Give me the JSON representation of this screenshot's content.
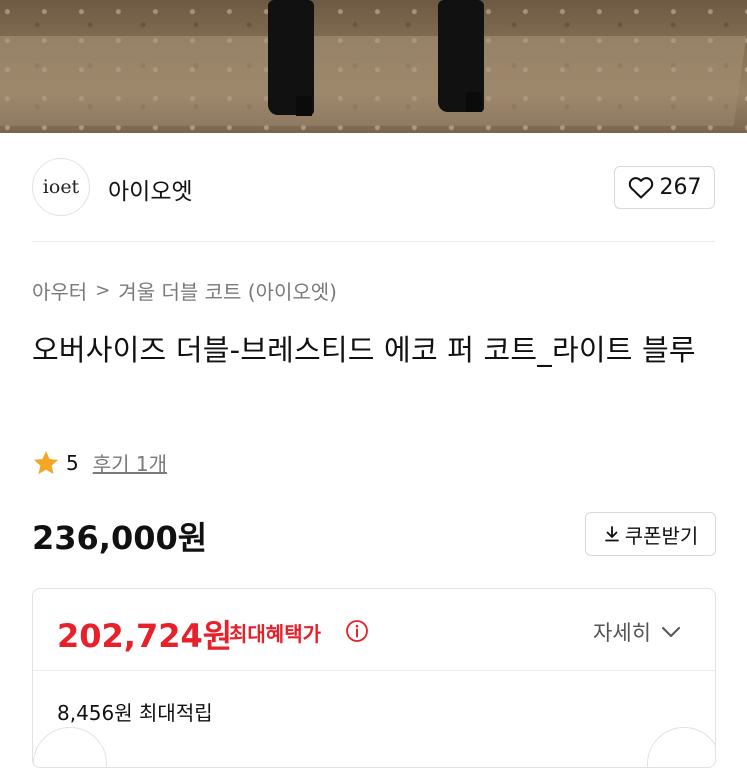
{
  "brand": {
    "logo_text": "ioet",
    "name": "아이오엣",
    "like_count": "267"
  },
  "breadcrumb": {
    "items": [
      "아우터",
      "겨울 더블 코트 (아이오엣)"
    ],
    "separator": ">"
  },
  "product": {
    "title": "오버사이즈 더블-브레스티드 에코 퍼 코트_라이트 블루",
    "rating": "5",
    "reviews_label": "후기 1개",
    "price": "236,000원",
    "coupon_label": "쿠폰받기"
  },
  "benefit": {
    "max_price": "202,724원",
    "max_label": "최대혜택가",
    "detail_label": "자세히",
    "points_label": "8,456원 최대적립"
  },
  "colors": {
    "accent_red": "#e8202a",
    "star": "#f5a623",
    "muted_text": "#7a7a7a"
  },
  "icons": {
    "like": "heart-outline-icon",
    "coupon": "download-icon",
    "info": "info-circle-icon",
    "detail": "chevron-down-icon",
    "rating": "star-icon"
  }
}
